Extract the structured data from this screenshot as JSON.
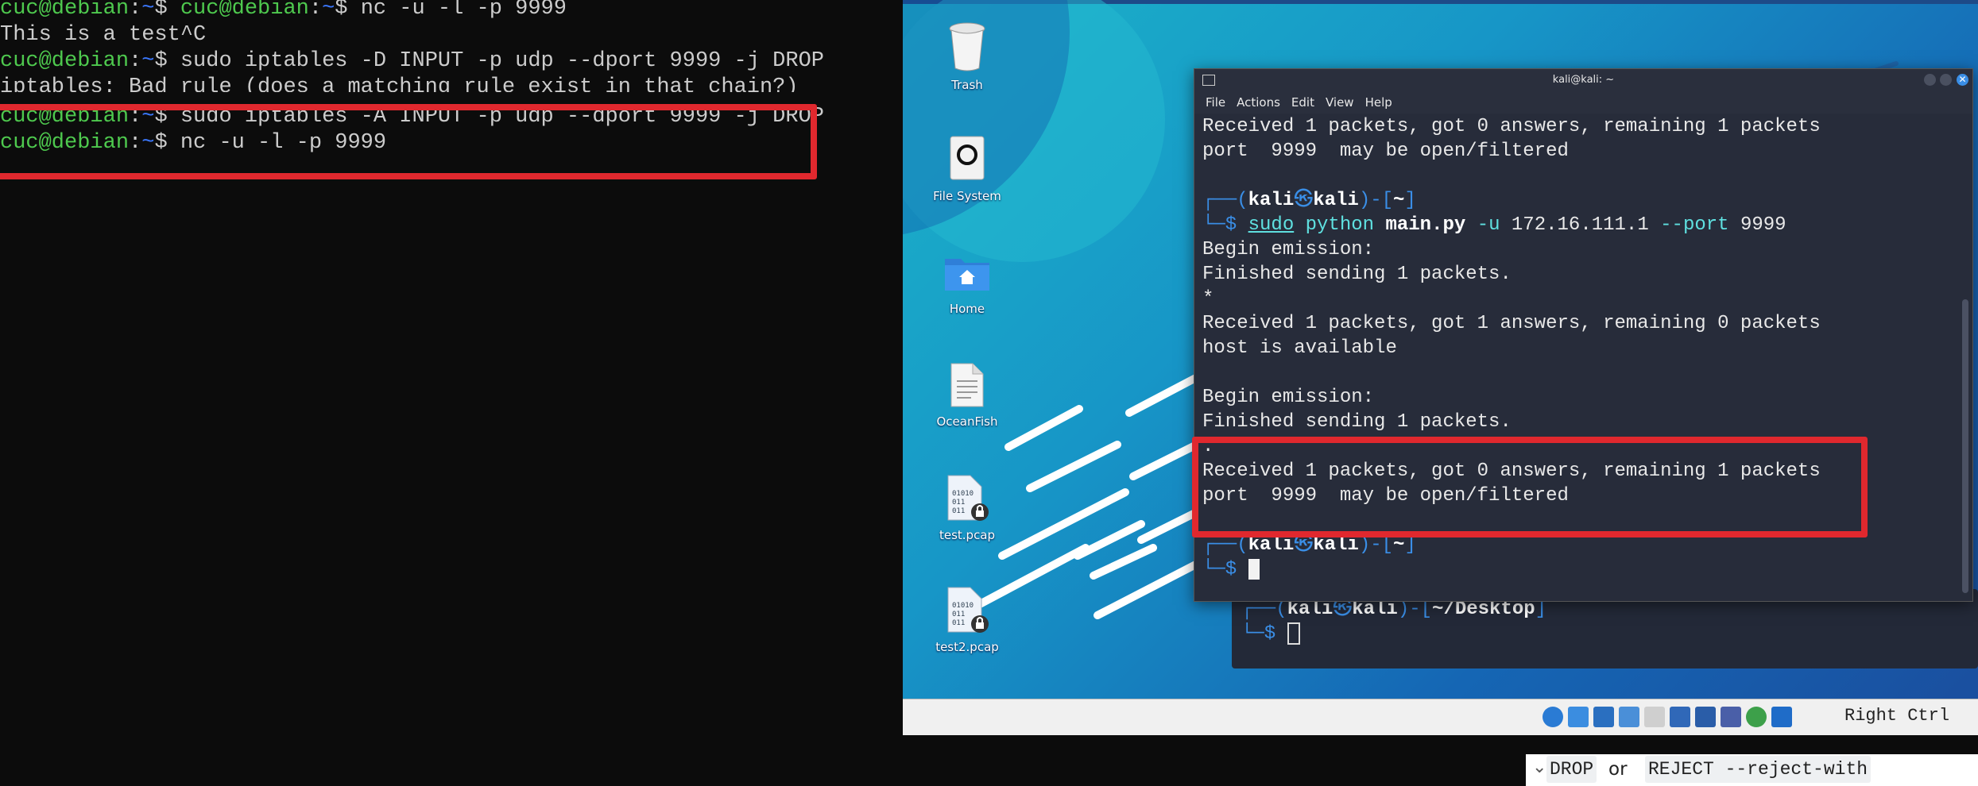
{
  "debian_terminal": {
    "lines": [
      {
        "prompt": "cuc@debian",
        "path": "~",
        "sym": "$ ",
        "extra_prompt": "cuc@debian",
        "cmd": "nc -u -l -p 9999"
      },
      {
        "text": "This is a test^C"
      },
      {
        "prompt": "cuc@debian",
        "path": "~",
        "sym": "$ ",
        "cmd": "sudo iptables -D INPUT -p udp --dport 9999 -j DROP"
      },
      {
        "text": "iptables: Bad rule (does a matching rule exist in that chain?)"
      },
      {
        "prompt": "cuc@debian",
        "path": "~",
        "sym": "$ ",
        "cmd": "sudo iptables -A INPUT -p udp --dport 9999 -j DROP"
      },
      {
        "prompt": "cuc@debian",
        "path": "~",
        "sym": "$ ",
        "cmd": "nc -u -l -p 9999"
      }
    ],
    "sep": ":"
  },
  "desktop": {
    "icons": [
      {
        "label": "Trash",
        "icon": "trash-icon"
      },
      {
        "label": "File System",
        "icon": "drive-icon"
      },
      {
        "label": "Home",
        "icon": "home-folder-icon"
      },
      {
        "label": "OceanFish",
        "icon": "text-file-icon"
      },
      {
        "label": "test.pcap",
        "icon": "binary-file-locked-icon"
      },
      {
        "label": "test2.pcap",
        "icon": "binary-file-locked-icon"
      }
    ]
  },
  "kali_terminal": {
    "title": "kali@kali: ~",
    "menu": [
      "File",
      "Actions",
      "Edit",
      "View",
      "Help"
    ],
    "lines": [
      "Received 1 packets, got 0 answers, remaining 1 packets",
      "port  9999  may be open/filtered",
      "",
      "Begin emission:",
      "Finished sending 1 packets.",
      "*",
      "Received 1 packets, got 1 answers, remaining 0 packets",
      "host is available",
      "",
      "Begin emission:",
      "Finished sending 1 packets.",
      ".",
      "Received 1 packets, got 0 answers, remaining 1 packets",
      "port  9999  may be open/filtered"
    ],
    "prompt_user": "kali",
    "prompt_at": "㉿",
    "prompt_host": "kali",
    "prompt_dir": "~",
    "prompt_cmd_sudo": "sudo",
    "prompt_cmd_python": "python",
    "prompt_cmd_file": "main.py",
    "prompt_cmd_args1": "-u",
    "prompt_cmd_ip": "172.16.111.1",
    "prompt_cmd_args2": "--port",
    "prompt_cmd_port": "9999"
  },
  "kali_back_terminal": {
    "prompt_user": "kali",
    "prompt_host": "kali",
    "prompt_dir": "~/Desktop"
  },
  "status_bar": {
    "host_key": "Right Ctrl"
  },
  "doc_snippet": {
    "chevron": "⌄",
    "code1": "DROP",
    "or": "or",
    "code2": "REJECT --reject-with"
  }
}
